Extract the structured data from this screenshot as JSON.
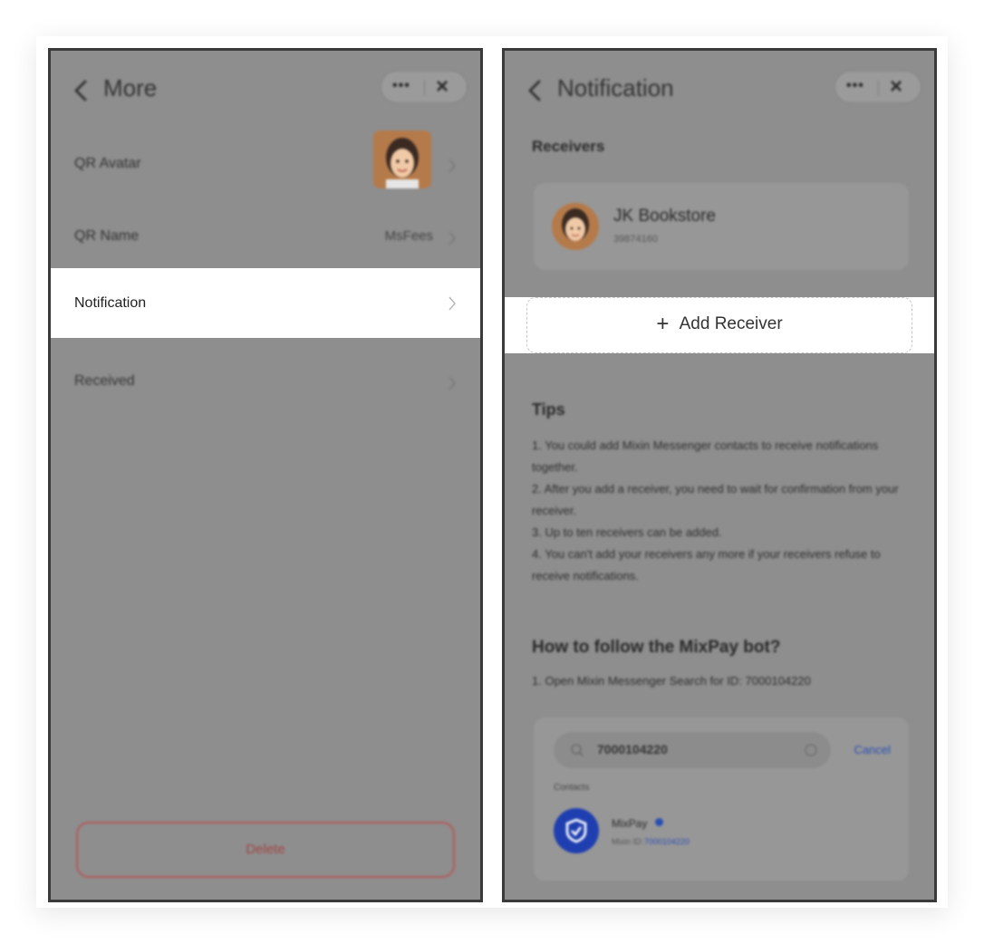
{
  "left_screen": {
    "title": "More",
    "rows": [
      {
        "label": "QR Avatar",
        "value": ""
      },
      {
        "label": "QR Name",
        "value": "MsFees"
      },
      {
        "label": "Notification",
        "value": ""
      },
      {
        "label": "Received",
        "value": ""
      }
    ],
    "delete_label": "Delete"
  },
  "right_screen": {
    "title": "Notification",
    "receivers_heading": "Receivers",
    "receiver": {
      "name": "JK Bookstore",
      "id": "39874160"
    },
    "add_receiver_label": "Add Receiver",
    "tips_heading": "Tips",
    "tips": [
      "1. You could add Mixin Messenger contacts to receive notifications together.",
      "2. After you add a receiver, you need to wait for confirmation from your receiver.",
      "3. Up to ten receivers can be added.",
      "4. You can't add your receivers any more if your receivers refuse to receive notifications."
    ],
    "follow_heading": "How to follow the MixPay bot?",
    "follow_step": "1. Open Mixin Messenger Search for ID: 7000104220",
    "search": {
      "query": "7000104220",
      "cancel_label": "Cancel",
      "section_label": "Contacts",
      "result_name": "MixPay",
      "result_id_prefix": "Mixin ID:",
      "result_id": "7000104220"
    }
  },
  "colors": {
    "dim_overlay": "#8e8e8e",
    "highlight": "#ffffff",
    "delete_red": "#a14444",
    "link_blue": "#2a4fb4",
    "bot_blue": "#1f3fb0"
  },
  "icons": [
    "back-chevron-icon",
    "more-dots-icon",
    "close-icon",
    "chevron-right-icon",
    "plus-icon",
    "search-icon",
    "clear-icon",
    "verified-badge-icon",
    "mixpay-shield-icon"
  ]
}
